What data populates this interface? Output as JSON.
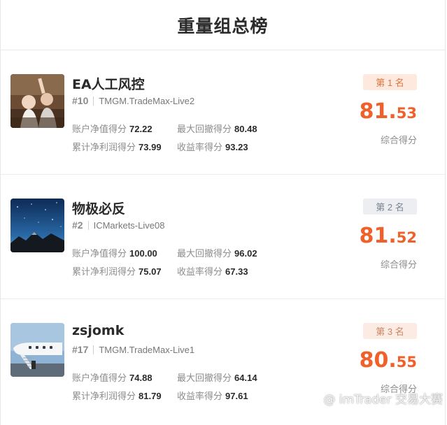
{
  "header": {
    "title": "重量组总榜"
  },
  "entries": [
    {
      "name": "EA人工风控",
      "rank_no": "#10",
      "server": "TMGM.TradeMax-Live2",
      "place_label": "第 1 名",
      "scores": {
        "net_value_label": "账户净值得分",
        "net_value": "72.22",
        "max_drawdown_label": "最大回撤得分",
        "max_drawdown": "80.48",
        "cum_profit_label": "累计净利润得分",
        "cum_profit": "73.99",
        "return_rate_label": "收益率得分",
        "return_rate": "93.23"
      },
      "total_int": "81",
      "total_dot": ".",
      "total_dec": "53",
      "total_label": "综合得分"
    },
    {
      "name": "物极必反",
      "rank_no": "#2",
      "server": "ICMarkets-Live08",
      "place_label": "第 2 名",
      "scores": {
        "net_value_label": "账户净值得分",
        "net_value": "100.00",
        "max_drawdown_label": "最大回撤得分",
        "max_drawdown": "96.02",
        "cum_profit_label": "累计净利润得分",
        "cum_profit": "75.07",
        "return_rate_label": "收益率得分",
        "return_rate": "67.33"
      },
      "total_int": "81",
      "total_dot": ".",
      "total_dec": "52",
      "total_label": "综合得分"
    },
    {
      "name": "zsjomk",
      "rank_no": "#17",
      "server": "TMGM.TradeMax-Live1",
      "place_label": "第 3 名",
      "scores": {
        "net_value_label": "账户净值得分",
        "net_value": "74.88",
        "max_drawdown_label": "最大回撤得分",
        "max_drawdown": "64.14",
        "cum_profit_label": "累计净利润得分",
        "cum_profit": "81.79",
        "return_rate_label": "收益率得分",
        "return_rate": "97.61"
      },
      "total_int": "80",
      "total_dot": ".",
      "total_dec": "55",
      "total_label": "综合得分"
    }
  ],
  "watermark": {
    "text": "@ imTrader 交易大赛",
    "icon": "wechat-logo-icon"
  },
  "colors": {
    "accent": "#f0602a",
    "badge_gold_bg": "#fde9de",
    "badge_silver_bg": "#eceef2",
    "badge_bronze_bg": "#fcebe3"
  }
}
